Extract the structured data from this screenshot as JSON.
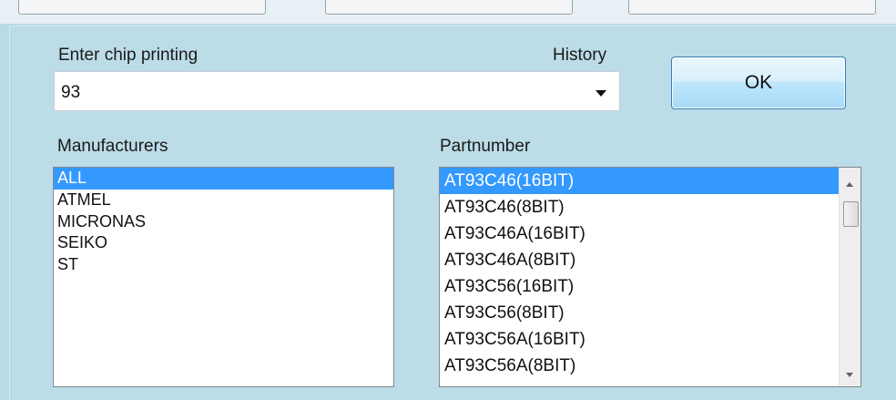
{
  "dialog": {
    "chip_label": "Enter chip printing",
    "history_label": "History",
    "chip_value": "93",
    "ok_label": "OK",
    "manufacturers_label": "Manufacturers",
    "partnumber_label": "Partnumber",
    "manufacturers": [
      "ALL",
      "ATMEL",
      "MICRONAS",
      "SEIKO",
      "ST"
    ],
    "manufacturer_selected": "ALL",
    "partnumbers": [
      "AT93C46(16BIT)",
      "AT93C46(8BIT)",
      "AT93C46A(16BIT)",
      "AT93C46A(8BIT)",
      "AT93C56(16BIT)",
      "AT93C56(8BIT)",
      "AT93C56A(16BIT)",
      "AT93C56A(8BIT)"
    ],
    "partnumber_selected": "AT93C46(16BIT)"
  },
  "colors": {
    "window_background": "#b9dbe6",
    "selection": "#3399ff",
    "button_border": "#3c7fb1"
  }
}
